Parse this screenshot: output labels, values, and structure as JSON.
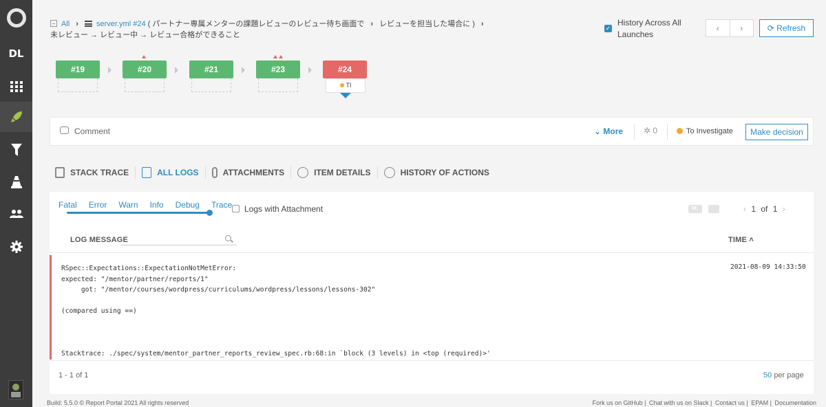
{
  "sidebar": {
    "logo": "report-portal-logo",
    "project_short": "DL",
    "items": [
      {
        "name": "dashboard",
        "icon": "grid-icon"
      },
      {
        "name": "launches",
        "icon": "rocket-icon",
        "active": true
      },
      {
        "name": "filters",
        "icon": "funnel-icon"
      },
      {
        "name": "debug",
        "icon": "cone-icon"
      },
      {
        "name": "members",
        "icon": "users-icon"
      },
      {
        "name": "settings",
        "icon": "gear-icon"
      }
    ]
  },
  "breadcrumb": {
    "all": "All",
    "item": "server.yml #24",
    "path1": "( パートナー専属メンターの課題レビューのレビュー待ち画面で",
    "path2": "レビューを担当した場合に )",
    "line2": "未レビュー → レビュー中 → レビュー合格ができること"
  },
  "header": {
    "history_across_all_launches": "History Across All Launches",
    "history_checked": true,
    "prev": "‹",
    "next": "›",
    "refresh": "Refresh"
  },
  "history": [
    {
      "label": "#19",
      "status": "passed"
    },
    {
      "label": "#20",
      "status": "passed",
      "growth": 1
    },
    {
      "label": "#21",
      "status": "passed"
    },
    {
      "label": "#23",
      "status": "passed",
      "growth": 2
    },
    {
      "label": "#24",
      "status": "failed",
      "defect": "TI"
    }
  ],
  "comment_bar": {
    "comment": "Comment",
    "more": "More",
    "bug_count": "0",
    "defect_type": "To Investigate",
    "make_decision": "Make decision"
  },
  "tabs": [
    {
      "label": "STACK TRACE"
    },
    {
      "label": "ALL LOGS",
      "active": true
    },
    {
      "label": "ATTACHMENTS"
    },
    {
      "label": "ITEM DETAILS"
    },
    {
      "label": "HISTORY OF ACTIONS"
    }
  ],
  "logs": {
    "levels": [
      "Fatal",
      "Error",
      "Warn",
      "Info",
      "Debug",
      "Trace"
    ],
    "level_selected": "Trace",
    "logs_with_attachment": "Logs with Attachment",
    "page": "1",
    "of": "of",
    "total_pages": "1",
    "col_message": "LOG MESSAGE",
    "col_time": "TIME",
    "rows": [
      {
        "level": "error",
        "message": "RSpec::Expectations::ExpectationNotMetError:\nexpected: \"/mentor/partner/reports/1\"\n     got: \"/mentor/courses/wordpress/curriculums/wordpress/lessons/lessons-302\"\n\n(compared using ==)\n\n\n\nStacktrace: ./spec/system/mentor_partner_reports_review_spec.rb:68:in `block (3 levels) in <top (required)>'",
        "time": "2021-08-09 14:33:50"
      }
    ],
    "count": "1 - 1 of 1",
    "per_page_n": "50",
    "per_page": "per page"
  },
  "footer": {
    "build": "Build: 5.5.0   © Report Portal 2021 All rights reserved",
    "links": [
      "Fork us on GitHub",
      "Chat with us on Slack",
      "Contact us",
      "EPAM",
      "Documentation"
    ]
  },
  "colors": {
    "accent": "#2f8cc3",
    "passed": "#5cb870",
    "failed": "#e36966",
    "to_investigate": "#f7a535",
    "sidebar": "#3c3c3c"
  }
}
